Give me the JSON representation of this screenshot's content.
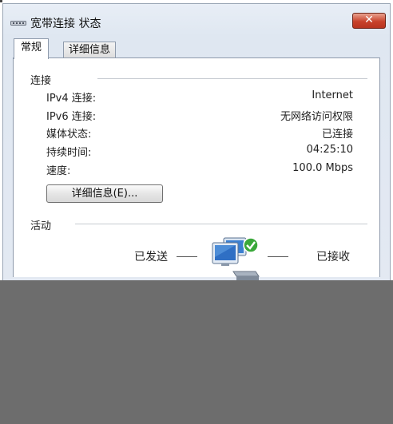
{
  "window": {
    "title": "宽带连接 状态",
    "close_label": "✕"
  },
  "tabs": [
    {
      "label": "常规"
    },
    {
      "label": "详细信息"
    }
  ],
  "connection": {
    "section_title": "连接",
    "rows": [
      {
        "label": "IPv4 连接:",
        "value": "Internet"
      },
      {
        "label": "IPv6 连接:",
        "value": "无网络访问权限"
      },
      {
        "label": "媒体状态:",
        "value": "已连接"
      },
      {
        "label": "持续时间:",
        "value": "04:25:10"
      },
      {
        "label": "速度:",
        "value": "100.0 Mbps"
      }
    ],
    "details_button": "详细信息(E)..."
  },
  "activity": {
    "section_title": "活动",
    "sent_label": "已发送",
    "received_label": "已接收"
  },
  "colors": {
    "close_button": "#c8422b",
    "obscured_area": "#6d6d6d"
  },
  "icons": {
    "title": "network-connection-icon",
    "activity": "network-computers-icon"
  }
}
